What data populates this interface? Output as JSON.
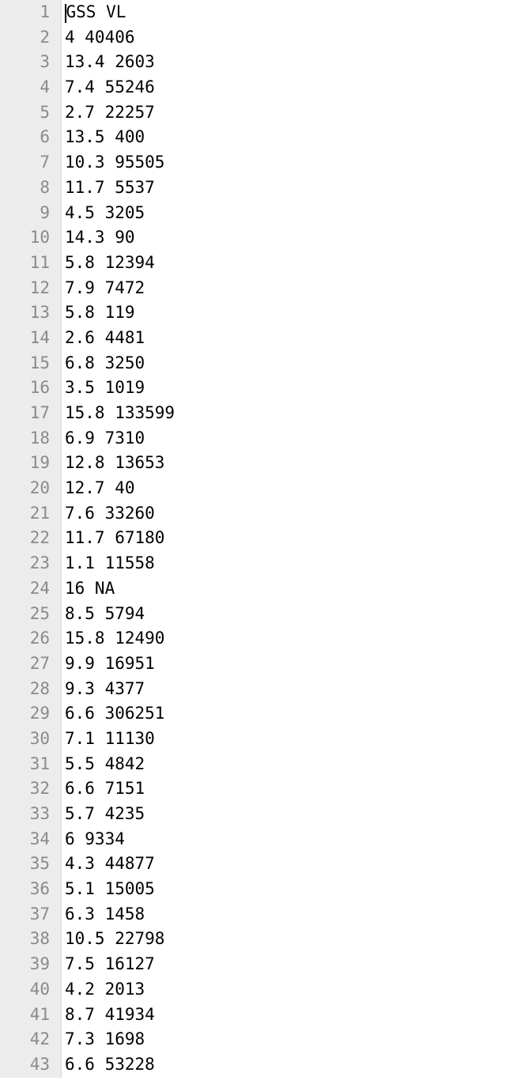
{
  "lines": [
    "GSS VL",
    "4 40406",
    "13.4 2603",
    "7.4 55246",
    "2.7 22257",
    "13.5 400",
    "10.3 95505",
    "11.7 5537",
    "4.5 3205",
    "14.3 90",
    "5.8 12394",
    "7.9 7472",
    "5.8 119",
    "2.6 4481",
    "6.8 3250",
    "3.5 1019",
    "15.8 133599",
    "6.9 7310",
    "12.8 13653",
    "12.7 40",
    "7.6 33260",
    "11.7 67180",
    "1.1 11558",
    "16 NA",
    "8.5 5794",
    "15.8 12490",
    "9.9 16951",
    "9.3 4377",
    "6.6 306251",
    "7.1 11130",
    "5.5 4842",
    "6.6 7151",
    "5.7 4235",
    "6 9334",
    "4.3 44877",
    "5.1 15005",
    "6.3 1458",
    "10.5 22798",
    "7.5 16127",
    "4.2 2013",
    "8.7 41934",
    "7.3 1698",
    "6.6 53228"
  ],
  "chart_data": {
    "type": "table",
    "columns": [
      "GSS",
      "VL"
    ],
    "rows": [
      [
        "4",
        "40406"
      ],
      [
        "13.4",
        "2603"
      ],
      [
        "7.4",
        "55246"
      ],
      [
        "2.7",
        "22257"
      ],
      [
        "13.5",
        "400"
      ],
      [
        "10.3",
        "95505"
      ],
      [
        "11.7",
        "5537"
      ],
      [
        "4.5",
        "3205"
      ],
      [
        "14.3",
        "90"
      ],
      [
        "5.8",
        "12394"
      ],
      [
        "7.9",
        "7472"
      ],
      [
        "5.8",
        "119"
      ],
      [
        "2.6",
        "4481"
      ],
      [
        "6.8",
        "3250"
      ],
      [
        "3.5",
        "1019"
      ],
      [
        "15.8",
        "133599"
      ],
      [
        "6.9",
        "7310"
      ],
      [
        "12.8",
        "13653"
      ],
      [
        "12.7",
        "40"
      ],
      [
        "7.6",
        "33260"
      ],
      [
        "11.7",
        "67180"
      ],
      [
        "1.1",
        "11558"
      ],
      [
        "16",
        "NA"
      ],
      [
        "8.5",
        "5794"
      ],
      [
        "15.8",
        "12490"
      ],
      [
        "9.9",
        "16951"
      ],
      [
        "9.3",
        "4377"
      ],
      [
        "6.6",
        "306251"
      ],
      [
        "7.1",
        "11130"
      ],
      [
        "5.5",
        "4842"
      ],
      [
        "6.6",
        "7151"
      ],
      [
        "5.7",
        "4235"
      ],
      [
        "6",
        "9334"
      ],
      [
        "4.3",
        "44877"
      ],
      [
        "5.1",
        "15005"
      ],
      [
        "6.3",
        "1458"
      ],
      [
        "10.5",
        "22798"
      ],
      [
        "7.5",
        "16127"
      ],
      [
        "4.2",
        "2013"
      ],
      [
        "8.7",
        "41934"
      ],
      [
        "7.3",
        "1698"
      ],
      [
        "6.6",
        "53228"
      ]
    ]
  }
}
